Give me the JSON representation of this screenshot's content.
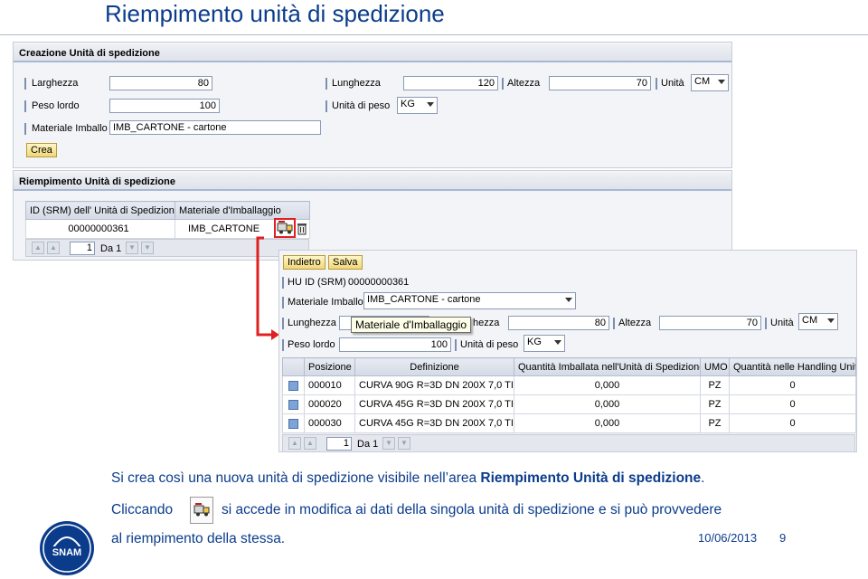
{
  "slide": {
    "title": "Riempimento unità di spedizione",
    "date": "10/06/2013",
    "page_number": "9",
    "caption_line1_prefix": "Si crea così una nuova unità di spedizione visibile nell’area ",
    "caption_line1_bold": "Riempimento Unità di spedizione",
    "caption_line1_suffix": ".",
    "caption_line2_before": "Cliccando",
    "caption_line2_after": "si accede in modifica ai dati della singola unità di spedizione e si può provvedere",
    "caption_line3": "al riempimento della stessa."
  },
  "creation": {
    "title": "Creazione Unità di spedizione",
    "larghezza_label": "Larghezza",
    "larghezza_value": "80",
    "lunghezza_label": "Lunghezza",
    "lunghezza_value": "120",
    "altezza_label": "Altezza",
    "altezza_value": "70",
    "unita_label": "Unità",
    "unita_value": "CM",
    "peso_label": "Peso lordo",
    "peso_value": "100",
    "unita_peso_label": "Unità di peso",
    "unita_peso_value": "KG",
    "materiale_label": "Materiale Imballo",
    "materiale_value": "IMB_CARTONE - cartone",
    "crea_button": "Crea"
  },
  "filling": {
    "title": "Riempimento Unità di spedizione",
    "col_id": "ID (SRM) dell' Unità di Spedizione",
    "col_materiale": "Materiale d'Imballaggio",
    "row_id": "00000000361",
    "row_materiale": "IMB_CARTONE",
    "page_value": "1",
    "page_label": "Da 1"
  },
  "tooltip": "Materiale d'Imballaggio",
  "detail": {
    "indietro_button": "Indietro",
    "salva_button": "Salva",
    "hu_label": "HU ID (SRM)",
    "hu_value": "00000000361",
    "materiale_label": "Materiale Imballo",
    "materiale_value": "IMB_CARTONE - cartone",
    "lunghezza_label": "Lunghezza",
    "lunghezza_value": "",
    "larghezza_label_partial": "hezza",
    "larghezza_value": "80",
    "altezza_label": "Altezza",
    "altezza_value": "70",
    "unita_label": "Unità",
    "unita_value": "CM",
    "peso_label": "Peso lordo",
    "peso_value": "100",
    "unita_peso_label": "Unità di peso",
    "unita_peso_value": "KG"
  },
  "items_table": {
    "headers": [
      "Posizione",
      "Definizione",
      "Quantità Imballata nell'Unità di Spedizione",
      "UMO",
      "Quantità nelle Handling Unit"
    ],
    "rows": [
      [
        "000010",
        "CURVA 90G R=3D DN 200X 7,0 TI",
        "0,000",
        "PZ",
        "0"
      ],
      [
        "000020",
        "CURVA 45G R=3D DN 200X 7,0 TI",
        "0,000",
        "PZ",
        "0"
      ],
      [
        "000030",
        "CURVA 45G R=3D DN 200X 7,0 TI",
        "0,000",
        "PZ",
        "0"
      ]
    ],
    "page_value": "1",
    "page_label": "Da 1"
  },
  "colors": {
    "title_blue": "#0b3c8c",
    "callout_red": "#e02020",
    "sap_bg": "#f3f4f7"
  }
}
